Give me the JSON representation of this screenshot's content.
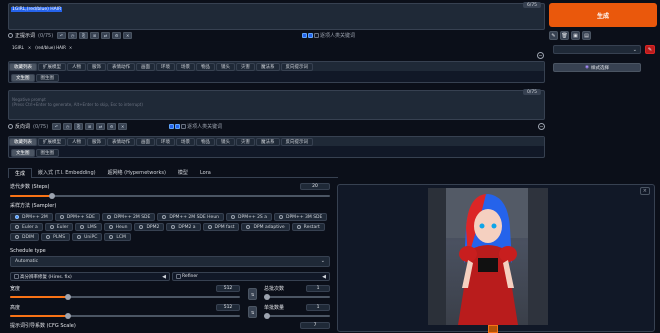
{
  "prompt": {
    "text": "1GIRL,(red/blue) HAIR",
    "counter": "6/75"
  },
  "generate_button": "生成",
  "pos_controls": {
    "title": "正提示词",
    "counter_small": "(0/75)",
    "checkbox_label": "逐项人类关键词"
  },
  "token_row": {
    "t1": "1GIRL",
    "t2": "(red/blue) HAIR"
  },
  "pos_tabs": [
    "收藏列表",
    "扩展模型",
    "人物",
    "服饰",
    "表情动作",
    "画面",
    "环境",
    "场景",
    "物品",
    "镜头",
    "灾害",
    "魔法系",
    "反向提示词"
  ],
  "pos_subtabs": [
    "文生图",
    "图生图"
  ],
  "neg_prompt": {
    "placeholder": "Negative prompt\n(Press Ctrl+Enter to generate, Alt+Enter to skip, Esc to interrupt)",
    "counter": "0/75"
  },
  "neg_controls": {
    "title": "反向词",
    "counter_small": "(0/75)",
    "checkbox_label": "逐项人类关键词"
  },
  "neg_tabs": [
    "收藏列表",
    "扩展模型",
    "人物",
    "服饰",
    "表情动作",
    "画面",
    "环境",
    "场景",
    "物品",
    "镜头",
    "灾害",
    "魔法系",
    "反向提示词"
  ],
  "neg_subtabs": [
    "文生图",
    "图生图"
  ],
  "right_tools": {
    "style_select_label": "样式选择"
  },
  "main_tabs": [
    "生成",
    "嵌入式 (T.I. Embedding)",
    "超网络 (Hypernetworks)",
    "模型",
    "Lora"
  ],
  "steps": {
    "label": "迭代步数 (Steps)",
    "value": "20",
    "fraction": 0.13
  },
  "sampler": {
    "label": "采样方法 (Sampler)",
    "options": [
      "DPM++ 2M",
      "DPM++ SDE",
      "DPM++ 2M SDE",
      "DPM++ 2M SDE Heun",
      "DPM++ 2S a",
      "DPM++ 3M SDE",
      "Euler a",
      "Euler",
      "LMS",
      "Heun",
      "DPM2",
      "DPM2 a",
      "DPM fast",
      "DPM adaptive",
      "Restart",
      "DDIM",
      "PLMS",
      "UniPC",
      "LCM"
    ],
    "selected": "DPM++ 2M"
  },
  "schedule": {
    "label": "Schedule type",
    "value": "Automatic"
  },
  "hires": {
    "label": "高分辨率修复 (Hires. fix)"
  },
  "refiner": {
    "label": "Refiner"
  },
  "width": {
    "label": "宽度",
    "value": "512",
    "fraction": 0.25
  },
  "height": {
    "label": "高度",
    "value": "512",
    "fraction": 0.25
  },
  "batch_count": {
    "label": "总批次数",
    "value": "1"
  },
  "batch_size": {
    "label": "单批数量",
    "value": "1"
  },
  "cfg": {
    "label": "提示词引导系数 (CFG Scale)",
    "value": "7"
  },
  "swap_label": "⇅",
  "swap_label2": "⇅",
  "preview_close": "×",
  "colors": {
    "accent": "#f97316",
    "bg": "#0b0f19",
    "panel": "#1f2937",
    "blue": "#3b82f6"
  }
}
